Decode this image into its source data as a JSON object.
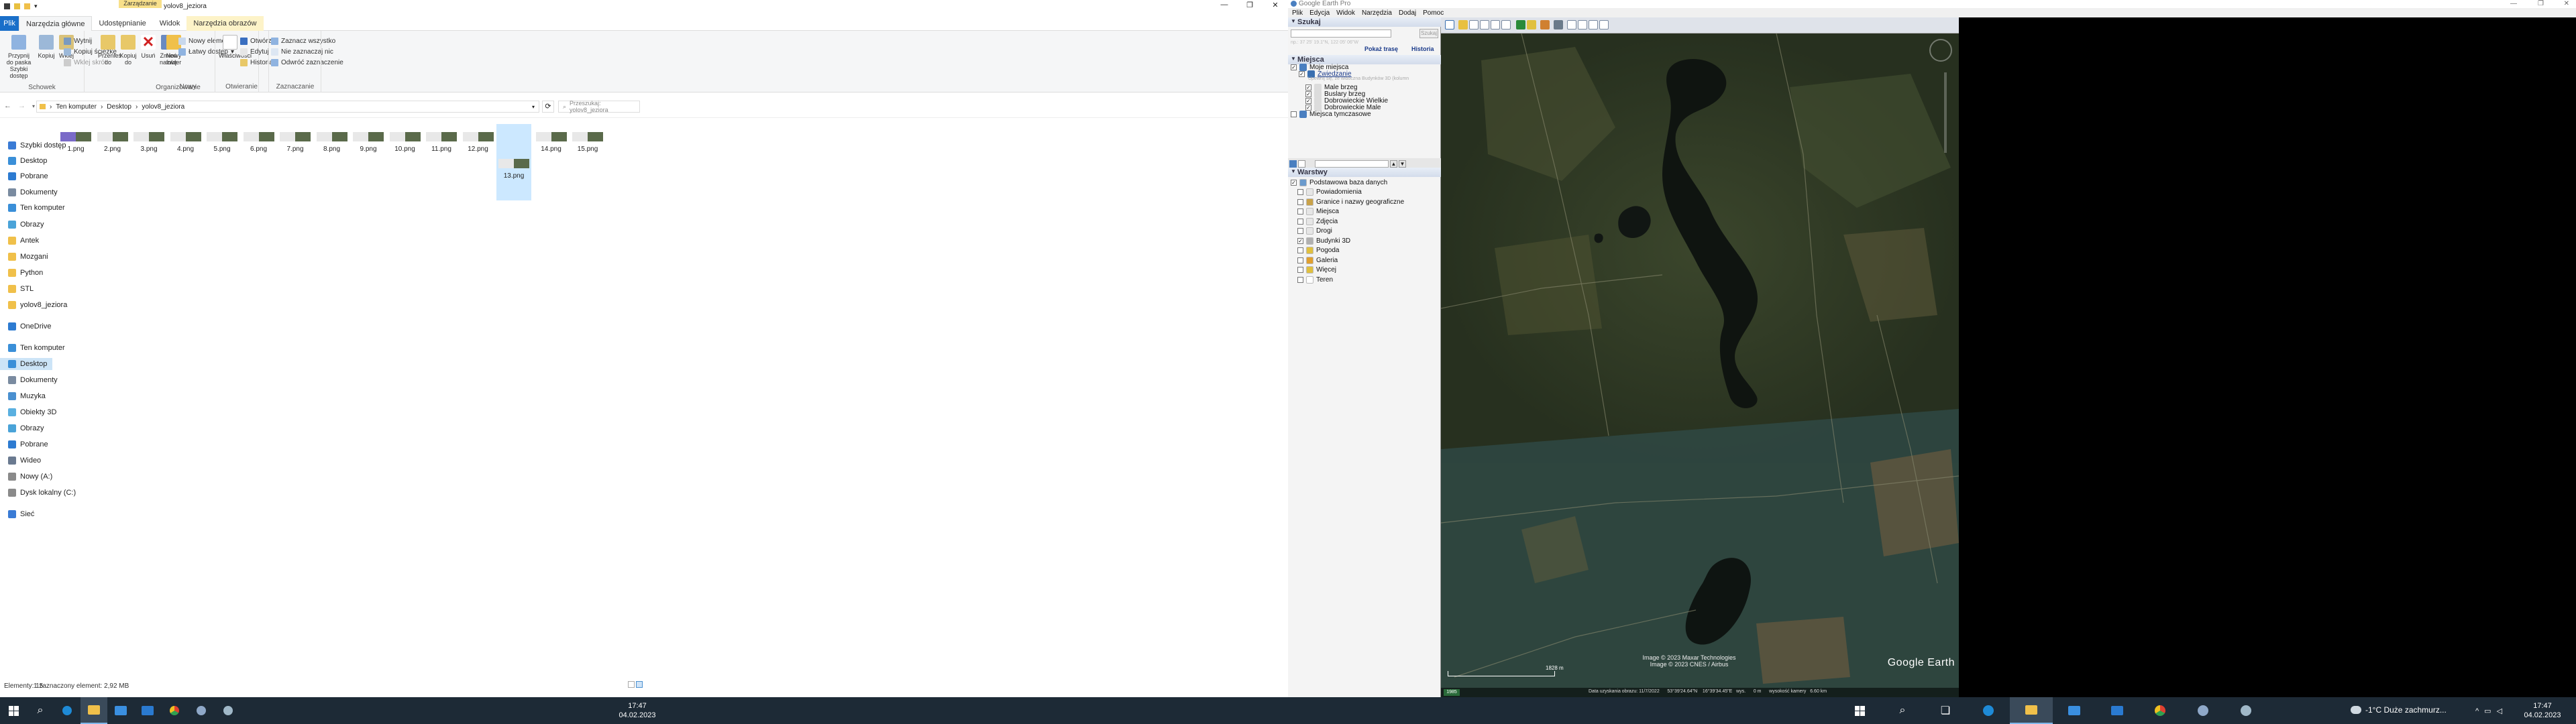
{
  "explorer": {
    "title": "yolov8_jeziora",
    "contextual_tab": "Zarządzanie",
    "tabs": [
      "Plik",
      "Narzędzia główne",
      "Udostępnianie",
      "Widok",
      "Narzędzia obrazów"
    ],
    "ribbon": {
      "pin": "Przypnij do paska Szybki dostęp",
      "copy": "Kopiuj",
      "paste": "Wklej",
      "cut": "Wytnij",
      "copy_path": "Kopiuj ścieżkę",
      "paste_shortcut": "Wklej skrót",
      "move_to": "Przenieś do",
      "copy_to": "Kopiuj do",
      "delete": "Usuń",
      "rename": "Zmień nazwę",
      "new_folder": "Nowy folder",
      "new_item": "Nowy element",
      "easy_access": "Łatwy dostęp",
      "properties": "Właściwości",
      "open": "Otwórz",
      "edit": "Edytuj",
      "history": "Historia",
      "select_all": "Zaznacz wszystko",
      "select_none": "Nie zaznaczaj nic",
      "invert": "Odwróć zaznaczenie",
      "groups": [
        "Schowek",
        "Organizowanie",
        "Nowy",
        "Otwieranie",
        "Zaznaczanie"
      ]
    },
    "breadcrumb": [
      "Ten komputer",
      "Desktop",
      "yolov8_jeziora"
    ],
    "search_placeholder": "Przeszukaj: yolov8_jeziora",
    "nav": [
      {
        "label": "Szybki dostęp",
        "c": "#3a7bd5"
      },
      {
        "label": "Desktop",
        "c": "#3a8fd8"
      },
      {
        "label": "Pobrane",
        "c": "#2d7bd1"
      },
      {
        "label": "Dokumenty",
        "c": "#7a8ba0"
      },
      {
        "label": "Ten komputer",
        "c": "#3a8fd8"
      },
      {
        "label": "Obrazy",
        "c": "#4aa3d8"
      },
      {
        "label": "Antek",
        "c": "#f0c04a"
      },
      {
        "label": "Mozgani",
        "c": "#f0c04a"
      },
      {
        "label": "Python",
        "c": "#f0c04a"
      },
      {
        "label": "STL",
        "c": "#f0c04a"
      },
      {
        "label": "yolov8_jeziora",
        "c": "#f0c04a"
      },
      {
        "label": "OneDrive",
        "c": "#2d7bd1"
      },
      {
        "label": "Ten komputer",
        "c": "#3a8fd8"
      },
      {
        "label": "Desktop",
        "c": "#3a8fd8"
      },
      {
        "label": "Dokumenty",
        "c": "#7a8ba0"
      },
      {
        "label": "Muzyka",
        "c": "#4a90d0"
      },
      {
        "label": "Obiekty 3D",
        "c": "#5ab0e0"
      },
      {
        "label": "Obrazy",
        "c": "#4aa3d8"
      },
      {
        "label": "Pobrane",
        "c": "#2d7bd1"
      },
      {
        "label": "Wideo",
        "c": "#6a7a90"
      },
      {
        "label": "Nowy (A:)",
        "c": "#8a8a8a"
      },
      {
        "label": "Dysk lokalny (C:)",
        "c": "#8a8a8a"
      },
      {
        "label": "Sieć",
        "c": "#3a7bd5"
      }
    ],
    "files": [
      "1.png",
      "2.png",
      "3.png",
      "4.png",
      "5.png",
      "6.png",
      "7.png",
      "8.png",
      "9.png",
      "10.png",
      "11.png",
      "12.png",
      "13.png",
      "14.png",
      "15.png"
    ],
    "selected_file": "13.png",
    "status_count": "Elementy: 15",
    "status_selected": "1 zaznaczony element: 2,92 MB"
  },
  "taskbar_left": {
    "time": "17:47",
    "date": "04.02.2023"
  },
  "ge": {
    "title": "Google Earth Pro",
    "menu": [
      "Plik",
      "Edycja",
      "Widok",
      "Narzędzia",
      "Dodaj",
      "Pomoc"
    ],
    "search_section": "Szukaj",
    "search_button": "Szukaj",
    "search_placeholder": "np.: 37 25' 19.1\"N, 122 05' 06\"W",
    "route_link": "Pokaż trasę",
    "history_link": "Historia",
    "places_section": "Miejsca",
    "places": [
      {
        "label": "Moje miejsca",
        "c": "#4a7fc0",
        "checked": "✓"
      },
      {
        "label": "Zwiedzanie",
        "c": "#3a6fb0",
        "checked": "✓"
      },
      {
        "label": "Male brzeg",
        "c": "#dcdcdc",
        "checked": "✓"
      },
      {
        "label": "Buslary brzeg",
        "c": "#dcdcdc",
        "checked": "✓"
      },
      {
        "label": "Dobrowieckie Wielkie",
        "c": "#dcdcdc",
        "checked": "✓"
      },
      {
        "label": "Dobrowieckie Male",
        "c": "#dcdcdc",
        "checked": "✓"
      },
      {
        "label": "Miejsca tymczasowe",
        "c": "#4a7fc0",
        "checked": ""
      }
    ],
    "tour_note": "Upewnij się, że widoczna Budynków 3D (kolumn",
    "layers_section": "Warstwy",
    "layers": [
      {
        "label": "Podstawowa baza danych",
        "c": "#6a9acd",
        "checked": "✓"
      },
      {
        "label": "Powiadomienia",
        "c": "#e6e6e6",
        "checked": ""
      },
      {
        "label": "Granice i nazwy geograficzne",
        "c": "#c9a24a",
        "checked": ""
      },
      {
        "label": "Miejsca",
        "c": "#e6e6e6",
        "checked": ""
      },
      {
        "label": "Zdjęcia",
        "c": "#e6e6e6",
        "checked": ""
      },
      {
        "label": "Drogi",
        "c": "#e6e6e6",
        "checked": ""
      },
      {
        "label": "Budynki 3D",
        "c": "#b0b0b0",
        "checked": "✓"
      },
      {
        "label": "Pogoda",
        "c": "#e0c040",
        "checked": ""
      },
      {
        "label": "Galeria",
        "c": "#e0a030",
        "checked": ""
      },
      {
        "label": "Więcej",
        "c": "#e0c040",
        "checked": ""
      },
      {
        "label": "Teren",
        "c": "#ffffff",
        "checked": ""
      }
    ],
    "copyright1": "Image © 2023 Maxar Technologies",
    "copyright2": "Image © 2023 CNES / Airbus",
    "logo": "Google Earth",
    "scale": "1828 m",
    "year": "1985",
    "status": "Data uzyskania obrazu: 11/7/2022      53°39'24.64\"N    16°39'34.45\"E   wys.      0 m      wysokość kamery   6.60 km"
  },
  "taskbar_right": {
    "weather": "-1°C  Duże zachmurz...",
    "time": "17:47",
    "date": "04.02.2023"
  }
}
